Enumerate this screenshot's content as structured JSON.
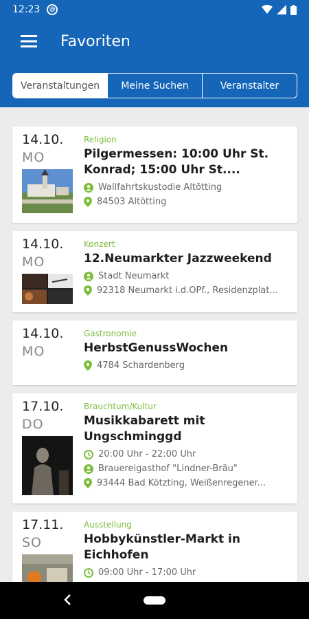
{
  "status_bar": {
    "time": "12:23"
  },
  "app_bar": {
    "title": "Favoriten"
  },
  "tabs": [
    {
      "label": "Veranstaltungen",
      "active": true
    },
    {
      "label": "Meine Suchen",
      "active": false
    },
    {
      "label": "Veranstalter",
      "active": false
    }
  ],
  "colors": {
    "primary": "#1565b8",
    "category": "#7cbd3b"
  },
  "events": [
    {
      "date": "14.10.",
      "dow": "MO",
      "category": "Religion",
      "title": "Pilgermessen: 10:00 Uhr St. Konrad; 15:00 Uhr St....",
      "organizer": "Wallfahrtskustodie Altötting",
      "location": "84503 Altötting"
    },
    {
      "date": "14.10.",
      "dow": "MO",
      "category": "Konzert",
      "title": "12.Neumarkter Jazzweekend",
      "organizer": "Stadt Neumarkt",
      "location": "92318 Neumarkt i.d.OPf., Residenzplat..."
    },
    {
      "date": "14.10.",
      "dow": "MO",
      "category": "Gastronomie",
      "title": "HerbstGenussWochen",
      "location": "4784 Schardenberg"
    },
    {
      "date": "17.10.",
      "dow": "DO",
      "category": "Brauchtum/Kultur",
      "title": "Musikkabarett mit Ungschminggd",
      "time": "20:00 Uhr - 22:00 Uhr",
      "organizer": "Brauereigasthof \"Lindner-Bräu\"",
      "location": "93444 Bad Kötzting, Weißenregener..."
    },
    {
      "date": "17.11.",
      "dow": "SO",
      "category": "Ausstellung",
      "title": "Hobbykünstler-Markt in Eichhofen",
      "time": "09:00 Uhr - 17:00 Uhr"
    }
  ]
}
